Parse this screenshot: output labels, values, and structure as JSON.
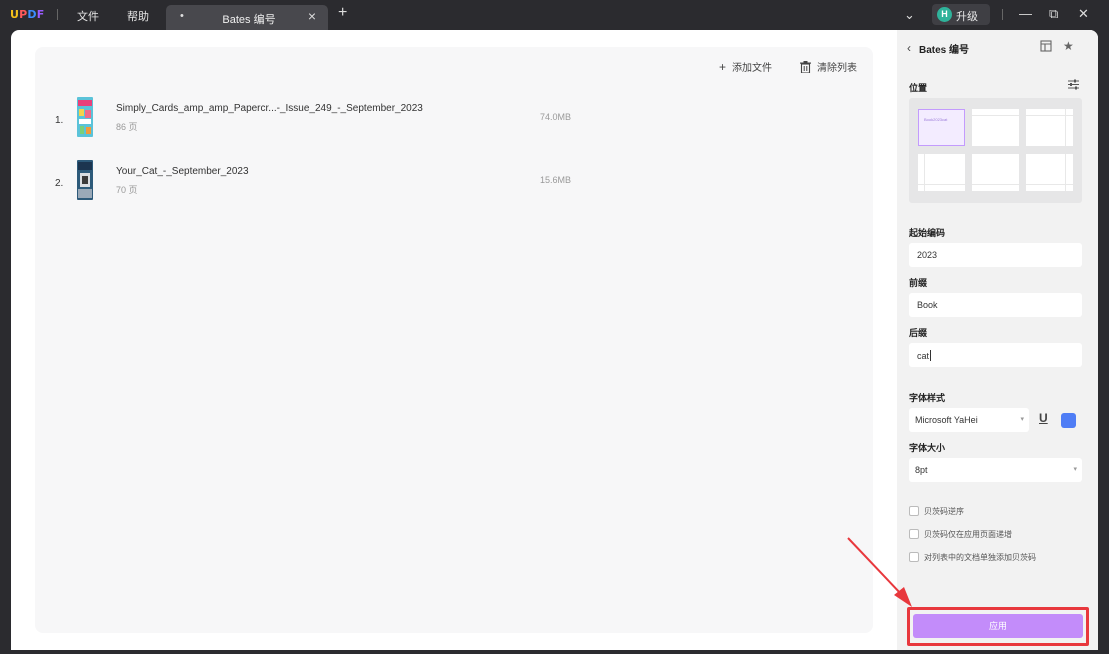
{
  "titlebar": {
    "logo": {
      "u": "U",
      "p": "P",
      "d": "D",
      "f": "F"
    },
    "menu_file": "文件",
    "menu_help": "帮助",
    "tab_dot": "•",
    "tab_title": "Bates 编号",
    "tab_close": "×",
    "tab_add": "+",
    "upgrade_avatar": "H",
    "upgrade_label": "升级",
    "dropdown": "⌄",
    "minimize": "—",
    "restore": "⧉",
    "close": "✕"
  },
  "main": {
    "add_file": "添加文件",
    "clear_list": "清除列表",
    "files": [
      {
        "index": "1.",
        "name": "Simply_Cards_amp_amp_Papercr...-_Issue_249_-_September_2023",
        "pages": "86 页",
        "size": "74.0MB"
      },
      {
        "index": "2.",
        "name": "Your_Cat_-_September_2023",
        "pages": "70 页",
        "size": "15.6MB"
      }
    ]
  },
  "panel": {
    "back": "‹",
    "title": "Bates 编号",
    "position_label": "位置",
    "selected_preview": "Book2023cat",
    "start_number_label": "起始编码",
    "start_number_value": "2023",
    "prefix_label": "前缀",
    "prefix_value": "Book",
    "suffix_label": "后缀",
    "suffix_value": "cat",
    "font_style_label": "字体样式",
    "font_family": "Microsoft YaHei",
    "underline_btn": "U",
    "font_size_label": "字体大小",
    "font_size": "8pt",
    "checkboxes": [
      "贝茨码逆序",
      "贝茨码仅在应用页面递增",
      "对列表中的文档单独添加贝茨码"
    ],
    "apply_label": "应用"
  },
  "colors": {
    "accent": "#c38cfa",
    "highlight": "#e8383d",
    "font_color": "#4f7df5"
  }
}
